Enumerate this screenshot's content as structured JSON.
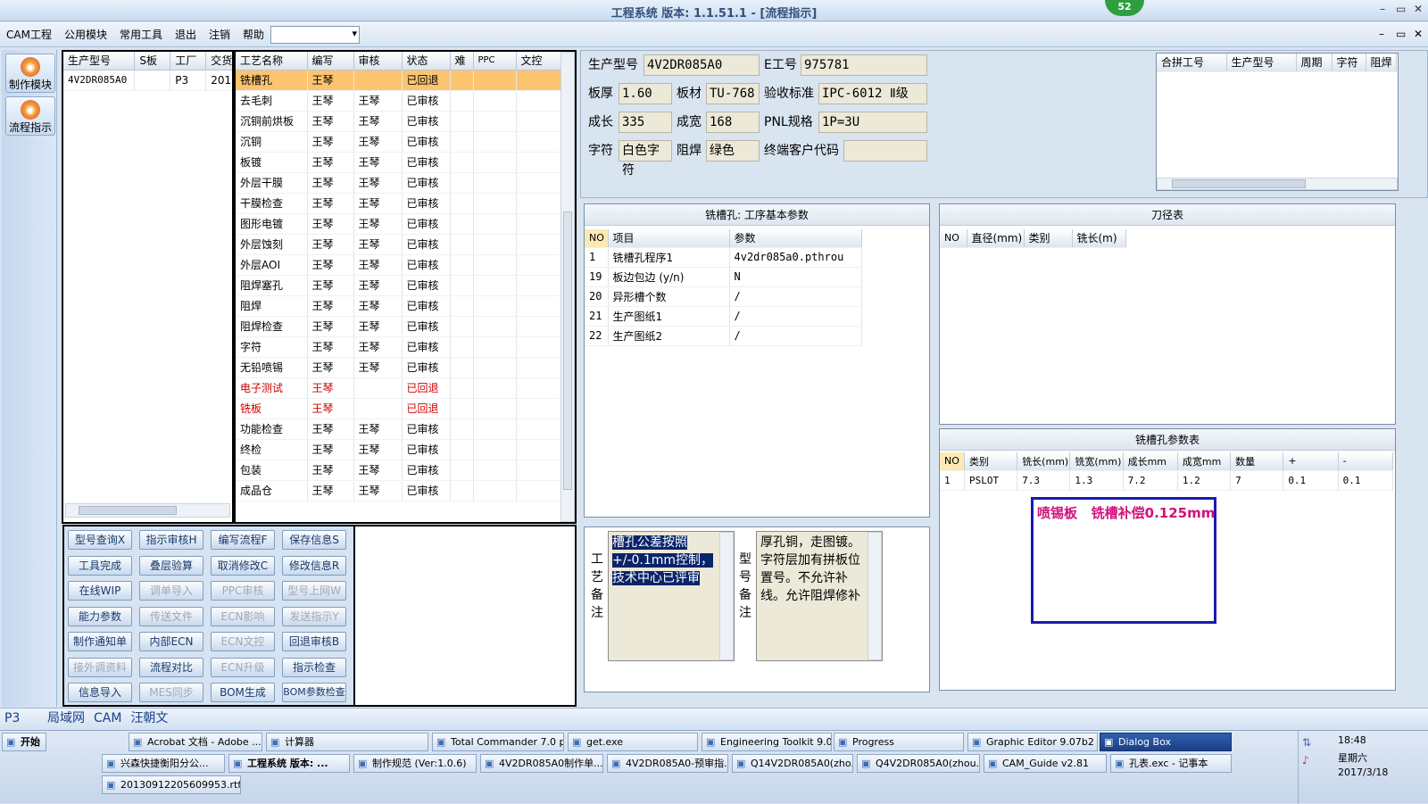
{
  "window": {
    "title": "工程系统  版本: 1.1.51.1 - [流程指示]",
    "badge": "52",
    "controls": [
      "–",
      "▭",
      "✕"
    ],
    "mdi_controls": [
      "–",
      "▭",
      "✕"
    ]
  },
  "menu": [
    "CAM工程",
    "公用模块",
    "常用工具",
    "退出",
    "注销",
    "帮助"
  ],
  "menu_arrow": "▾",
  "leftbar": [
    {
      "label": "制作模块",
      "icon": "fire-icon"
    },
    {
      "label": "流程指示",
      "icon": "flow-icon"
    }
  ],
  "jobs": {
    "headers": [
      "生产型号",
      "S板",
      "工厂",
      "交货"
    ],
    "rows": [
      [
        "4V2DR085A0",
        "",
        "P3",
        "201"
      ]
    ]
  },
  "process": {
    "headers": [
      "工艺名称",
      "编写",
      "审核",
      "状态",
      "难",
      "PPC",
      "文控"
    ],
    "rows": [
      {
        "name": "铣槽孔",
        "writer": "王琴",
        "reviewer": "",
        "status": "已回退",
        "red": false,
        "sel": true
      },
      {
        "name": "去毛刺",
        "writer": "王琴",
        "reviewer": "王琴",
        "status": "已审核"
      },
      {
        "name": "沉铜前烘板",
        "writer": "王琴",
        "reviewer": "王琴",
        "status": "已审核"
      },
      {
        "name": "沉铜",
        "writer": "王琴",
        "reviewer": "王琴",
        "status": "已审核"
      },
      {
        "name": "板镀",
        "writer": "王琴",
        "reviewer": "王琴",
        "status": "已审核"
      },
      {
        "name": "外层干膜",
        "writer": "王琴",
        "reviewer": "王琴",
        "status": "已审核"
      },
      {
        "name": "干膜检查",
        "writer": "王琴",
        "reviewer": "王琴",
        "status": "已审核"
      },
      {
        "name": "图形电镀",
        "writer": "王琴",
        "reviewer": "王琴",
        "status": "已审核"
      },
      {
        "name": "外层蚀刻",
        "writer": "王琴",
        "reviewer": "王琴",
        "status": "已审核"
      },
      {
        "name": "外层AOI",
        "writer": "王琴",
        "reviewer": "王琴",
        "status": "已审核"
      },
      {
        "name": "阻焊塞孔",
        "writer": "王琴",
        "reviewer": "王琴",
        "status": "已审核"
      },
      {
        "name": "阻焊",
        "writer": "王琴",
        "reviewer": "王琴",
        "status": "已审核"
      },
      {
        "name": "阻焊检查",
        "writer": "王琴",
        "reviewer": "王琴",
        "status": "已审核"
      },
      {
        "name": "字符",
        "writer": "王琴",
        "reviewer": "王琴",
        "status": "已审核"
      },
      {
        "name": "无铅喷锡",
        "writer": "王琴",
        "reviewer": "王琴",
        "status": "已审核"
      },
      {
        "name": "电子测试",
        "writer": "王琴",
        "reviewer": "",
        "status": "已回退",
        "red": true
      },
      {
        "name": "铣板",
        "writer": "王琴",
        "reviewer": "",
        "status": "已回退",
        "red": true
      },
      {
        "name": "功能检查",
        "writer": "王琴",
        "reviewer": "王琴",
        "status": "已审核"
      },
      {
        "name": "终检",
        "writer": "王琴",
        "reviewer": "王琴",
        "status": "已审核"
      },
      {
        "name": "包装",
        "writer": "王琴",
        "reviewer": "王琴",
        "status": "已审核"
      },
      {
        "name": "成品仓",
        "writer": "王琴",
        "reviewer": "王琴",
        "status": "已审核"
      }
    ]
  },
  "info": {
    "model_label": "生产型号",
    "model": "4V2DR085A0",
    "e_label": "E工号",
    "e_no": "975781",
    "thick_label": "板厚",
    "thick": "1.60",
    "mat_label": "板材",
    "mat": "TU-768",
    "std_label": "验收标准",
    "std": "IPC-6012 Ⅱ级",
    "len_label": "成长",
    "len": "335",
    "wid_label": "成宽",
    "wid": "168",
    "pnl_label": "PNL规格",
    "pnl": "1P=3U",
    "char_label": "字符",
    "char": "白色字符",
    "mask_label": "阻焊",
    "mask": "绿色",
    "cust_label": "终端客户代码",
    "cust": ""
  },
  "combine": {
    "headers": [
      "合拼工号",
      "生产型号",
      "周期",
      "字符",
      "阻焊"
    ]
  },
  "basic": {
    "title": "铣槽孔: 工序基本参数",
    "headers": [
      "NO",
      "项目",
      "参数"
    ],
    "rows": [
      [
        "1",
        "铣槽孔程序1",
        "4v2dr085a0.pthrou"
      ],
      [
        "19",
        "板边包边 (y/n)",
        "N"
      ],
      [
        "20",
        "异形槽个数",
        "/"
      ],
      [
        "21",
        "生产图纸1",
        "/"
      ],
      [
        "22",
        "生产图纸2",
        "/"
      ]
    ]
  },
  "tools": {
    "title": "刀径表",
    "headers": [
      "NO",
      "直径(mm)",
      "类别",
      "铣长(m)"
    ]
  },
  "slot": {
    "title": "铣槽孔参数表",
    "headers": [
      "NO",
      "类别",
      "铣长(mm)",
      "铣宽(mm)",
      "成长mm",
      "成宽mm",
      "数量",
      "+",
      "-"
    ],
    "rows": [
      [
        "1",
        "PSLOT",
        "7.3",
        "1.3",
        "7.2",
        "1.2",
        "7",
        "0.1",
        "0.1"
      ]
    ]
  },
  "note_box": "喷锡板   铣槽补偿0.125mm",
  "process_note_label": "工艺备注",
  "process_note": "槽孔公差按照+/-0.1mm控制，技术中心已评审",
  "model_note_label": "型号备注",
  "model_note": "厚孔铜，走图镀。字符层加有拼板位置号。不允许补线。允许阻焊修补",
  "buttons": [
    {
      "l": "型号查询X",
      "d": false
    },
    {
      "l": "指示审核H",
      "d": false
    },
    {
      "l": "编写流程F",
      "d": false
    },
    {
      "l": "保存信息S",
      "d": false
    },
    {
      "l": "工具完成",
      "d": false
    },
    {
      "l": "叠层验算",
      "d": false
    },
    {
      "l": "取消修改C",
      "d": false
    },
    {
      "l": "修改信息R",
      "d": false
    },
    {
      "l": "在线WIP",
      "d": false
    },
    {
      "l": "调单导入",
      "d": true
    },
    {
      "l": "PPC审核",
      "d": true
    },
    {
      "l": "型号上网W",
      "d": true
    },
    {
      "l": "能力参数",
      "d": false
    },
    {
      "l": "传送文件",
      "d": true
    },
    {
      "l": "ECN影响",
      "d": true
    },
    {
      "l": "发送指示Y",
      "d": true
    },
    {
      "l": "制作通知单",
      "d": false
    },
    {
      "l": "内部ECN",
      "d": false
    },
    {
      "l": "ECN文控",
      "d": true
    },
    {
      "l": "回退审核B",
      "d": false
    },
    {
      "l": "接外调资料",
      "d": true
    },
    {
      "l": "流程对比",
      "d": false
    },
    {
      "l": "ECN升级",
      "d": true
    },
    {
      "l": "指示检查",
      "d": false
    },
    {
      "l": "信息导入",
      "d": false
    },
    {
      "l": "MES同步",
      "d": true
    },
    {
      "l": "BOM生成",
      "d": false
    },
    {
      "l": "BOM参数检查",
      "d": false
    }
  ],
  "status": [
    "P3",
    "局域网",
    "CAM",
    "汪朝文"
  ],
  "taskbar": {
    "start": "开始",
    "time": "18:48",
    "day": "星期六",
    "date": "2017/3/18",
    "row1": [
      "Acrobat 文档 - Adobe ...",
      "计算器",
      "Total Commander 7.0 p...",
      "get.exe",
      "Engineering Toolkit 9.0...",
      "Progress",
      "Graphic Editor 9.07b2 (...",
      "Dialog Box"
    ],
    "row2": [
      "兴森快捷衡阳分公...",
      "工程系统  版本: ...",
      "制作规范 (Ver:1.0.6)",
      "4V2DR085A0制作单...",
      "4V2DR085A0-预审指...",
      "Q14V2DR085A0(zho...",
      "Q4V2DR085A0(zhou...",
      "CAM_Guide v2.81",
      "孔表.exc - 记事本"
    ],
    "row3": [
      "20130912205609953.rtf..."
    ]
  }
}
